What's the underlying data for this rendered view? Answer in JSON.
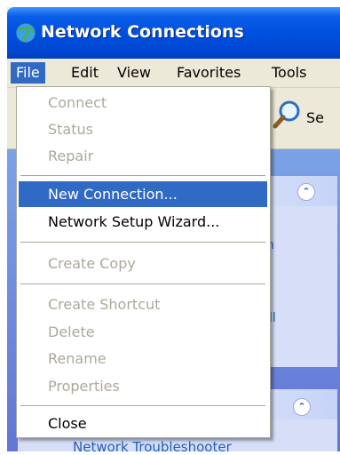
{
  "window": {
    "title": "Network Connections"
  },
  "menubar": {
    "items": [
      {
        "label": "File",
        "active": true
      },
      {
        "label": "Edit"
      },
      {
        "label": "View"
      },
      {
        "label": "Favorites"
      },
      {
        "label": "Tools"
      }
    ]
  },
  "toolbar": {
    "search_label": "Se"
  },
  "file_menu": {
    "items": [
      {
        "label": "Connect",
        "enabled": false
      },
      {
        "label": "Status",
        "enabled": false
      },
      {
        "label": "Repair",
        "enabled": false
      },
      {
        "label": "New Connection...",
        "enabled": true,
        "highlighted": true
      },
      {
        "label": "Network Setup Wizard...",
        "enabled": true
      },
      {
        "label": "Create Copy",
        "enabled": false
      },
      {
        "label": "Create Shortcut",
        "enabled": false
      },
      {
        "label": "Delete",
        "enabled": false
      },
      {
        "label": "Rename",
        "enabled": false
      },
      {
        "label": "Properties",
        "enabled": false
      },
      {
        "label": "Close",
        "enabled": true
      }
    ]
  },
  "taskpane": {
    "peek_1": "n",
    "peek_2": "ll",
    "troubleshooter": "Network Troubleshooter"
  },
  "colors": {
    "title_blue": "#0050e0",
    "highlight": "#316ac5",
    "disabled": "#aca899"
  }
}
